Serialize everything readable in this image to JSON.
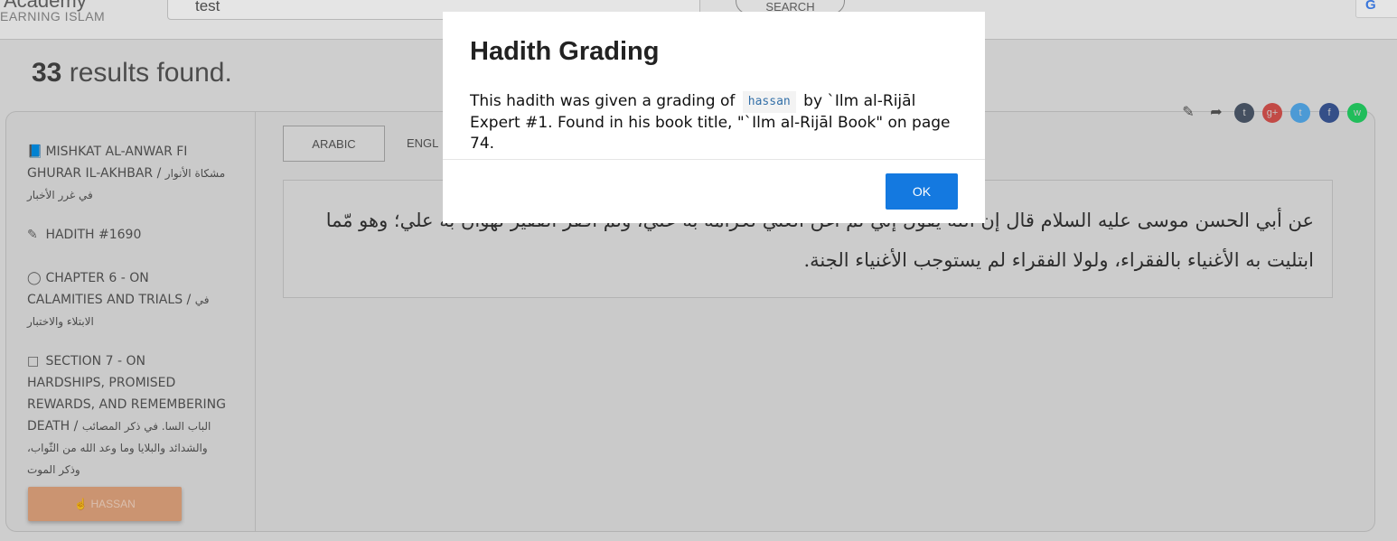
{
  "header": {
    "logo_title": "Academy",
    "logo_subtitle": "EARNING ISLAM",
    "search_value": "test",
    "search_button": "SEARCH",
    "google_letter": "G"
  },
  "results": {
    "count": "33",
    "suffix": " results found."
  },
  "sidebar": {
    "book": {
      "label": "MISHKAT AL-ANWAR FI GHURAR IL-AKHBAR / ",
      "arabic": "مشكاة الأنوار في غرر الأخبار"
    },
    "hadith": {
      "label": "HADITH #1690"
    },
    "chapter": {
      "label": "CHAPTER 6 - ON CALAMITIES AND TRIALS / ",
      "arabic": "في الابتلاء والاختبار"
    },
    "section": {
      "label": "SECTION 7 - ON HARDSHIPS, PROMISED REWARDS, AND REMEMBERING DEATH / ",
      "arabic": "الباب السا. في ذكر المصائب والشدائد والبلايا وما وعد الله من الثّواب، وذكر الموت"
    },
    "grade_button": "HASSAN"
  },
  "tabs": [
    {
      "label": "ARABIC"
    },
    {
      "label": "ENGL"
    }
  ],
  "hadith_text": "عن أبي الحسن موسى عليه السلام قال إن الله يقول إني لم أغن الغني لكرامة به علي، ولم أفقر الفقير لهوان به علي؛ وهو مّما ابتليت به الأغنياء بالفقراء، ولولا الفقراء لم يستوجب الأغنياء الجنة.",
  "share": {
    "google_plus": "g+",
    "tumblr": "t",
    "twitter": "t",
    "facebook": "f",
    "whatsapp": "w"
  },
  "colors": {
    "modal_button": "#1479e0",
    "grade_button": "#e3a57e",
    "tumblr": "#4d5a6b",
    "google_plus": "#d9534f",
    "twitter": "#55acee",
    "facebook": "#3b5998",
    "whatsapp": "#25d366"
  },
  "modal": {
    "title": "Hadith Grading",
    "text_before": "This hadith was given a grading of",
    "grade": "hassan",
    "text_after": "by `Ilm al-Rijāl Expert #1. Found in his book title, \"`Ilm al-Rijāl Book\" on page 74.",
    "ok_button": "OK"
  }
}
